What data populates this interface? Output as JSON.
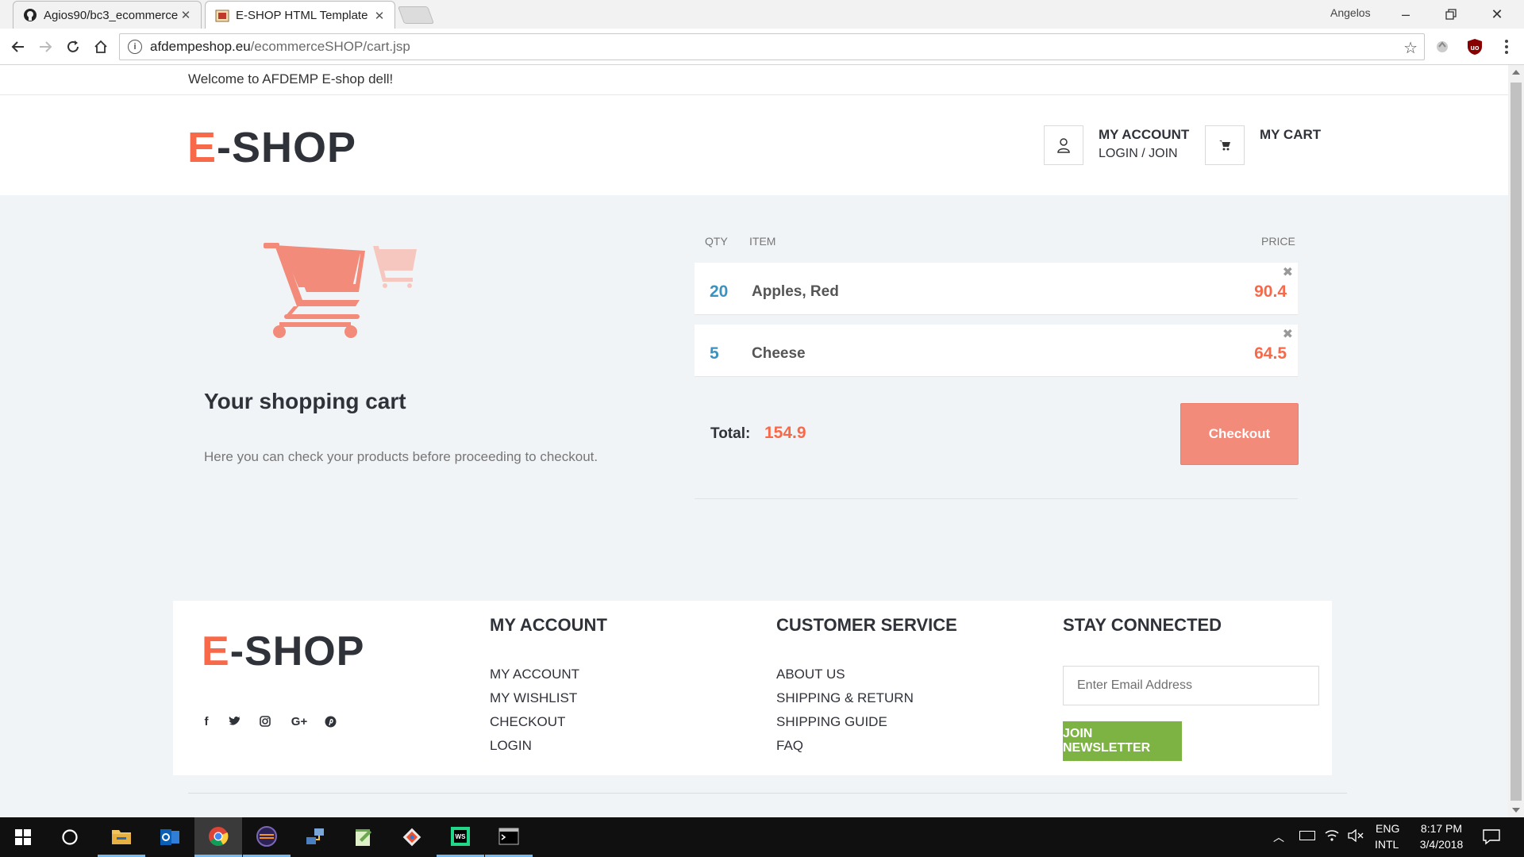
{
  "browser": {
    "tabs": [
      {
        "label": "Agios90/bc3_ecommerce",
        "icon": "github-icon"
      },
      {
        "label": "E-SHOP HTML Template",
        "icon": "site-favicon"
      }
    ],
    "profile_name": "Angelos",
    "url_host": "afdempeshop.eu",
    "url_path": "/ecommerceSHOP/cart.jsp"
  },
  "page": {
    "welcome": "Welcome to AFDEMP E-shop dell!",
    "logo_e": "E",
    "logo_rest": "-SHOP",
    "header": {
      "account_title": "MY ACCOUNT",
      "account_sub": "LOGIN / JOIN",
      "cart_title": "MY CART"
    },
    "cart": {
      "title": "Your shopping cart",
      "description": "Here you can check your products before proceeding to checkout.",
      "columns": {
        "qty": "QTY",
        "item": "ITEM",
        "price": "PRICE"
      },
      "items": [
        {
          "qty": "20",
          "name": "Apples, Red",
          "price": "90.4"
        },
        {
          "qty": "5",
          "name": "Cheese",
          "price": "64.5"
        }
      ],
      "total_label": "Total:",
      "total_value": "154.9",
      "checkout_label": "Checkout"
    },
    "footer": {
      "account_heading": "MY ACCOUNT",
      "account_links": [
        "MY ACCOUNT",
        "MY WISHLIST",
        "CHECKOUT",
        "LOGIN"
      ],
      "service_heading": "CUSTOMER SERVICE",
      "service_links": [
        "ABOUT US",
        "SHIPPING & RETURN",
        "SHIPPING GUIDE",
        "FAQ"
      ],
      "connect_heading": "STAY CONNECTED",
      "email_placeholder": "Enter Email Address",
      "newsletter_label": "JOIN NEWSLETTER",
      "social": [
        {
          "icon": "facebook-icon",
          "glyph": "f"
        },
        {
          "icon": "twitter-icon",
          "glyph": "t"
        },
        {
          "icon": "instagram-icon",
          "glyph": ""
        },
        {
          "icon": "google-plus-icon",
          "glyph": "G+"
        },
        {
          "icon": "pinterest-icon",
          "glyph": "p"
        }
      ]
    }
  },
  "taskbar": {
    "language": "ENG",
    "layout": "INTL",
    "time": "8:17 PM",
    "date": "3/4/2018"
  },
  "colors": {
    "accent": "#f8694a",
    "qty": "#3a92c1",
    "checkout": "#f28b7a",
    "newsletter": "#7cb342",
    "main_bg": "#f1f4f7"
  }
}
